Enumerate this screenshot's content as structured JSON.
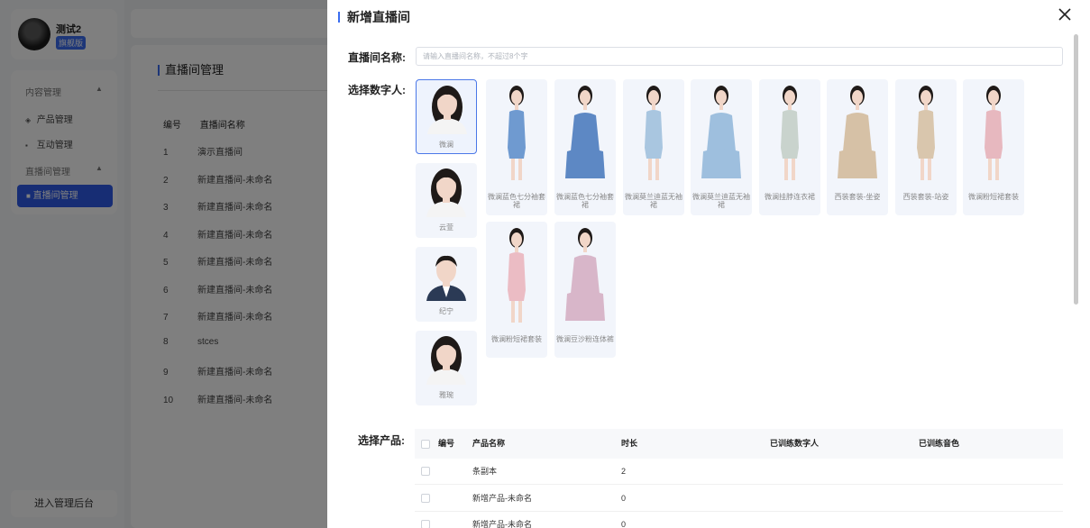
{
  "sidebar": {
    "user_name": "测试2",
    "user_badge": "旗舰版",
    "menu": {
      "group_content": "内容管理",
      "item_product": "产品管理",
      "item_interaction": "互动管理",
      "group_live": "直播间管理",
      "item_live_room": "直播间管理"
    },
    "admin_button": "进入管理后台"
  },
  "main": {
    "title": "直播间管理",
    "columns": [
      "编号",
      "直播间名称"
    ],
    "rows": [
      {
        "id": "1",
        "name": "演示直播间"
      },
      {
        "id": "2",
        "name": "新建直播间-未命名"
      },
      {
        "id": "3",
        "name": "新建直播间-未命名"
      },
      {
        "id": "4",
        "name": "新建直播间-未命名"
      },
      {
        "id": "5",
        "name": "新建直播间-未命名"
      },
      {
        "id": "6",
        "name": "新建直播间-未命名"
      },
      {
        "id": "7",
        "name": "新建直播间-未命名"
      },
      {
        "id": "8",
        "name": "stces"
      },
      {
        "id": "9",
        "name": "新建直播间-未命名"
      },
      {
        "id": "10",
        "name": "新建直播间-未命名"
      }
    ]
  },
  "drawer": {
    "title": "新增直播间",
    "name_label": "直播间名称:",
    "name_placeholder": "请输入直播间名称，不超过8个字",
    "digital_human_label": "选择数字人:",
    "digital_humans_portrait": [
      {
        "name": "微澜",
        "selected": true,
        "icon": "female-portrait-icon"
      },
      {
        "name": "云萱",
        "selected": false,
        "icon": "female-portrait-icon"
      },
      {
        "name": "纪宁",
        "selected": false,
        "icon": "male-portrait-icon"
      },
      {
        "name": "雅琬",
        "selected": false,
        "icon": "female-portrait-icon"
      }
    ],
    "digital_humans_full": [
      {
        "name": "微澜蓝色七分袖套裙",
        "color": "#6f9ad0"
      },
      {
        "name": "微澜蓝色七分袖套裙",
        "color": "#5d88c4"
      },
      {
        "name": "微澜莫兰迪蓝无袖裙",
        "color": "#a9c6e0"
      },
      {
        "name": "微澜莫兰迪蓝无袖裙",
        "color": "#9ebfde"
      },
      {
        "name": "微澜挂脖连衣裙",
        "color": "#c9d3cd"
      },
      {
        "name": "西装套装-坐姿",
        "color": "#d6c1a6"
      },
      {
        "name": "西装套装-站姿",
        "color": "#d9c6ad"
      },
      {
        "name": "微澜粉短裙套装",
        "color": "#e7b8bf"
      },
      {
        "name": "微澜粉短裙套装",
        "color": "#ebbcc4"
      },
      {
        "name": "微澜豆沙粉连体裤",
        "color": "#d8b6c9"
      }
    ],
    "product_label": "选择产品:",
    "product_columns": {
      "id": "编号",
      "name": "产品名称",
      "duration": "时长",
      "trained_human": "已训练数字人",
      "trained_voice": "已训练音色"
    },
    "products": [
      {
        "name": "条副本",
        "duration": "2"
      },
      {
        "name": "新增产品-未命名",
        "duration": "0"
      },
      {
        "name": "新增产品-未命名",
        "duration": "0"
      }
    ]
  }
}
